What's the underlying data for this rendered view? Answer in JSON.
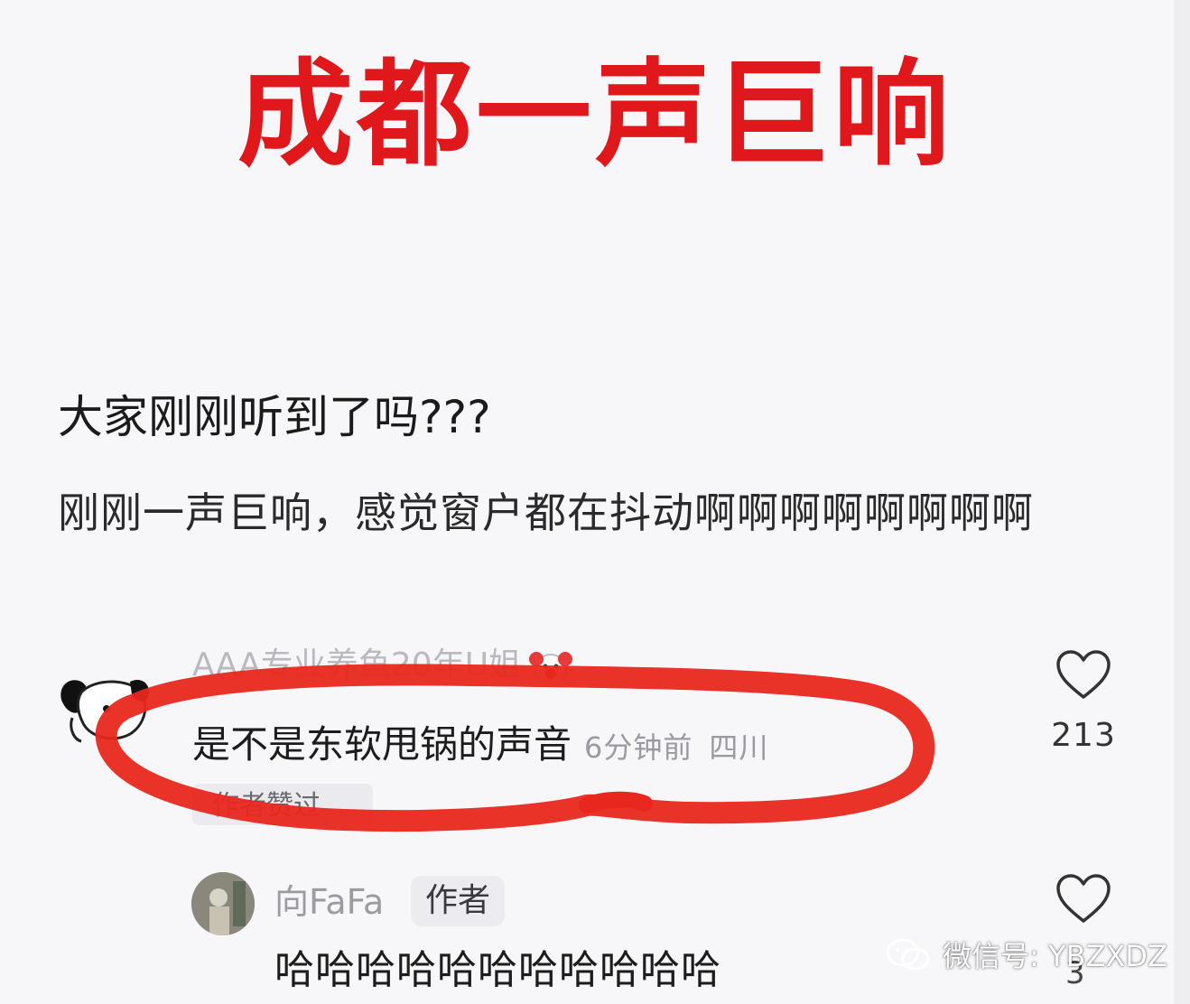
{
  "headline": "成都一声巨响",
  "post": {
    "title": "大家刚刚听到了吗???",
    "body": "刚刚一声巨响，感觉窗户都在抖动啊啊啊啊啊啊啊啊"
  },
  "comment": {
    "username": "AAA专业养鱼20年U姐",
    "text": "是不是东软甩锅的声音",
    "time": "6分钟前",
    "region": "四川",
    "liked_badge": "作者赞过",
    "like_count": "213"
  },
  "reply": {
    "username": "向FaFa",
    "author_badge": "作者",
    "text": "哈哈哈哈哈哈哈哈哈哈哈",
    "like_count": "3"
  },
  "watermark": {
    "text": "微信号: YBZXDZ"
  },
  "colors": {
    "headline": "#e0181c",
    "annotation_circle": "#e8281e",
    "background": "#f7f7f9"
  },
  "icons": [
    "heart-icon",
    "clown-emoji-icon",
    "dog-avatar-icon",
    "wechat-icon"
  ]
}
